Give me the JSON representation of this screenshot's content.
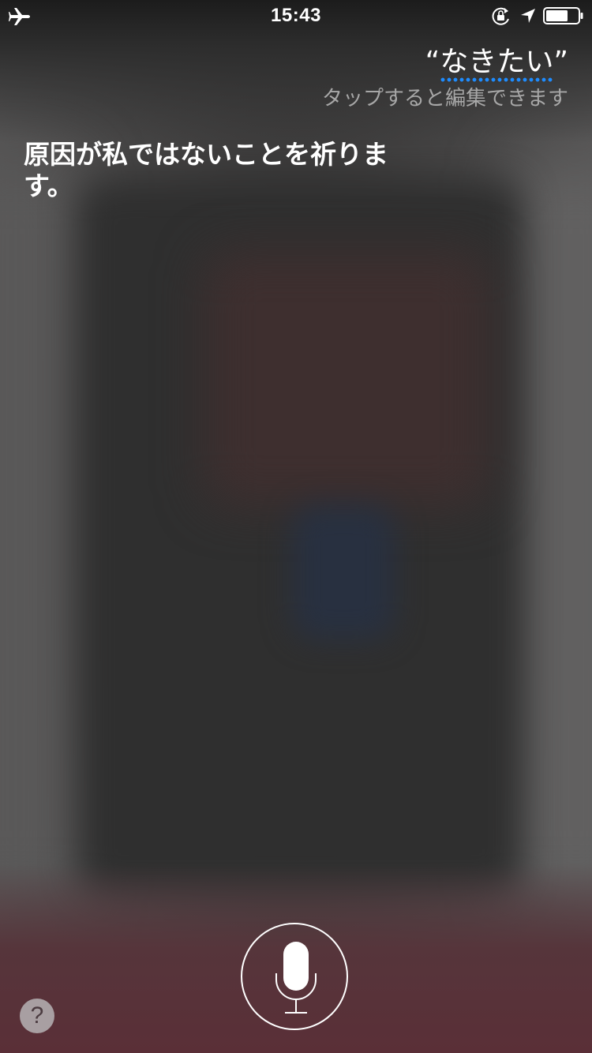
{
  "status_bar": {
    "time": "15:43",
    "icons": [
      "airplane-icon",
      "rotation-lock-icon",
      "location-icon",
      "battery-icon"
    ]
  },
  "speech": {
    "open_quote": "“",
    "text": "なきたい",
    "close_quote": "”",
    "edit_hint": "タップすると編集できます"
  },
  "response": {
    "text": "原因が私ではないことを祈ります。"
  },
  "controls": {
    "mic_icon": "microphone-icon",
    "help_label": "?"
  },
  "colors": {
    "speech_underline": "#1e8cff",
    "bottom_tint": "#5a2f37"
  }
}
